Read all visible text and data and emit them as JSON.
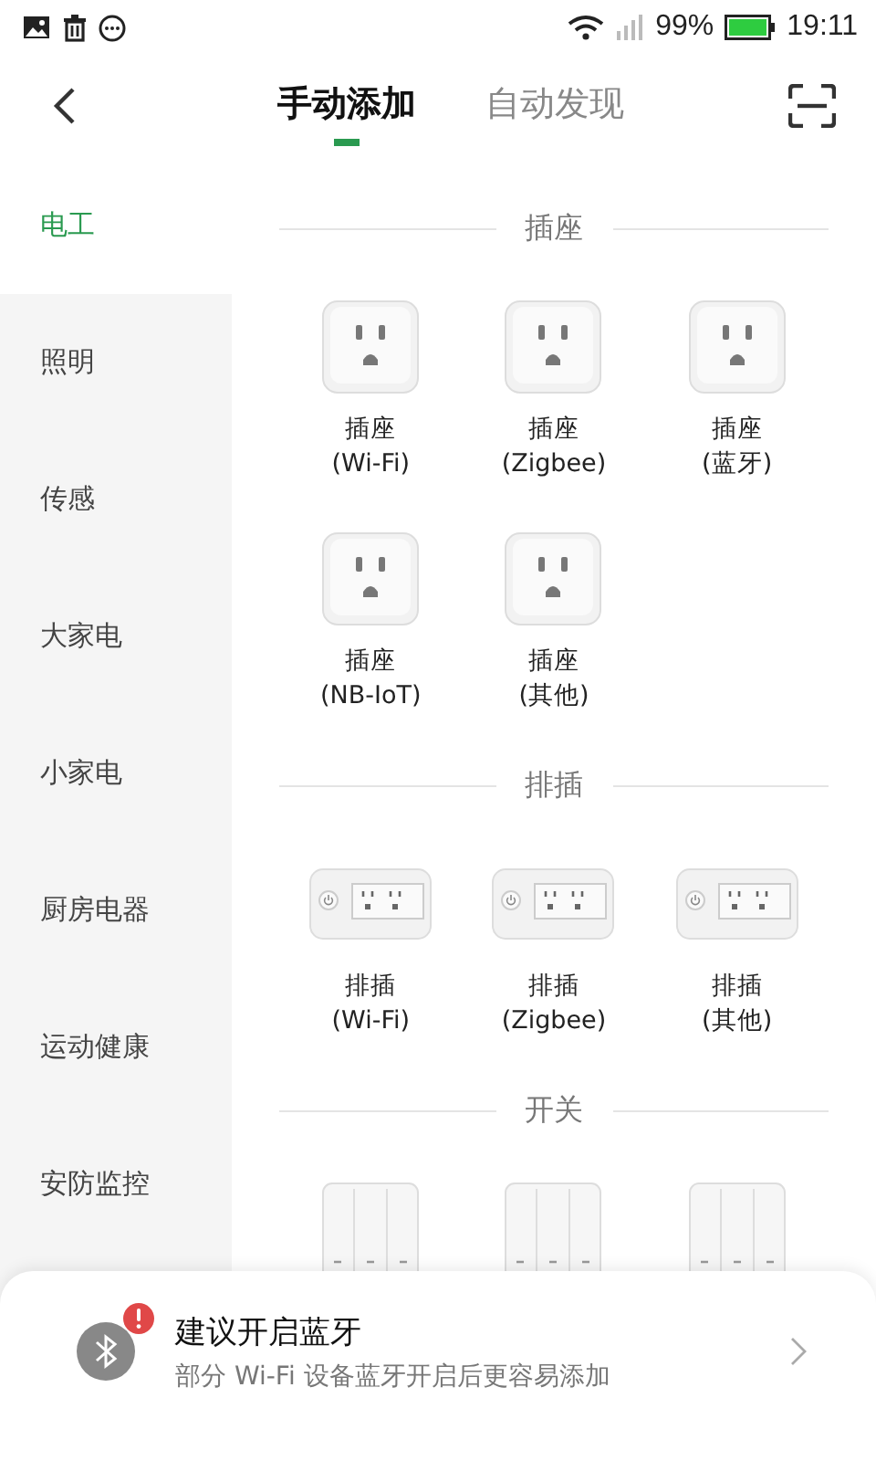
{
  "status_bar": {
    "battery": "99%",
    "time": "19:11"
  },
  "tabs": [
    {
      "label": "手动添加",
      "selected": true
    },
    {
      "label": "自动发现",
      "selected": false
    }
  ],
  "sidebar": {
    "items": [
      {
        "label": "电工",
        "selected": true
      },
      {
        "label": "照明",
        "selected": false
      },
      {
        "label": "传感",
        "selected": false
      },
      {
        "label": "大家电",
        "selected": false
      },
      {
        "label": "小家电",
        "selected": false
      },
      {
        "label": "厨房电器",
        "selected": false
      },
      {
        "label": "运动健康",
        "selected": false
      },
      {
        "label": "安防监控",
        "selected": false
      }
    ]
  },
  "sections": [
    {
      "title": "插座",
      "devices": [
        {
          "kind": "socket",
          "name": "插座",
          "protocol": "(Wi-Fi)"
        },
        {
          "kind": "socket",
          "name": "插座",
          "protocol": "(Zigbee)"
        },
        {
          "kind": "socket",
          "name": "插座",
          "protocol": "(蓝牙)"
        },
        {
          "kind": "socket",
          "name": "插座",
          "protocol": "(NB-IoT)"
        },
        {
          "kind": "socket",
          "name": "插座",
          "protocol": "(其他)"
        }
      ]
    },
    {
      "title": "排插",
      "devices": [
        {
          "kind": "strip",
          "name": "排插",
          "protocol": "(Wi-Fi)"
        },
        {
          "kind": "strip",
          "name": "排插",
          "protocol": "(Zigbee)"
        },
        {
          "kind": "strip",
          "name": "排插",
          "protocol": "(其他)"
        }
      ]
    },
    {
      "title": "开关",
      "devices": [
        {
          "kind": "switch"
        },
        {
          "kind": "switch"
        },
        {
          "kind": "switch"
        }
      ]
    }
  ],
  "bluetooth_prompt": {
    "title": "建议开启蓝牙",
    "subtitle": "部分 Wi-Fi 设备蓝牙开启后更容易添加"
  }
}
